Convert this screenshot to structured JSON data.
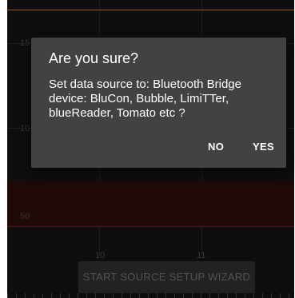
{
  "chart": {
    "y_labels": [
      "15",
      "10",
      "50"
    ],
    "x_labels": [
      "10",
      "11"
    ]
  },
  "wizard_button": {
    "label": "START SOURCE SETUP WIZARD"
  },
  "dialog": {
    "title": "Are you sure?",
    "message": "Set data source to: Bluetooth Bridge device: BluCon, Bubble, LimiTTer, blueReader, Tomato etc ?",
    "no_label": "NO",
    "yes_label": "YES"
  }
}
